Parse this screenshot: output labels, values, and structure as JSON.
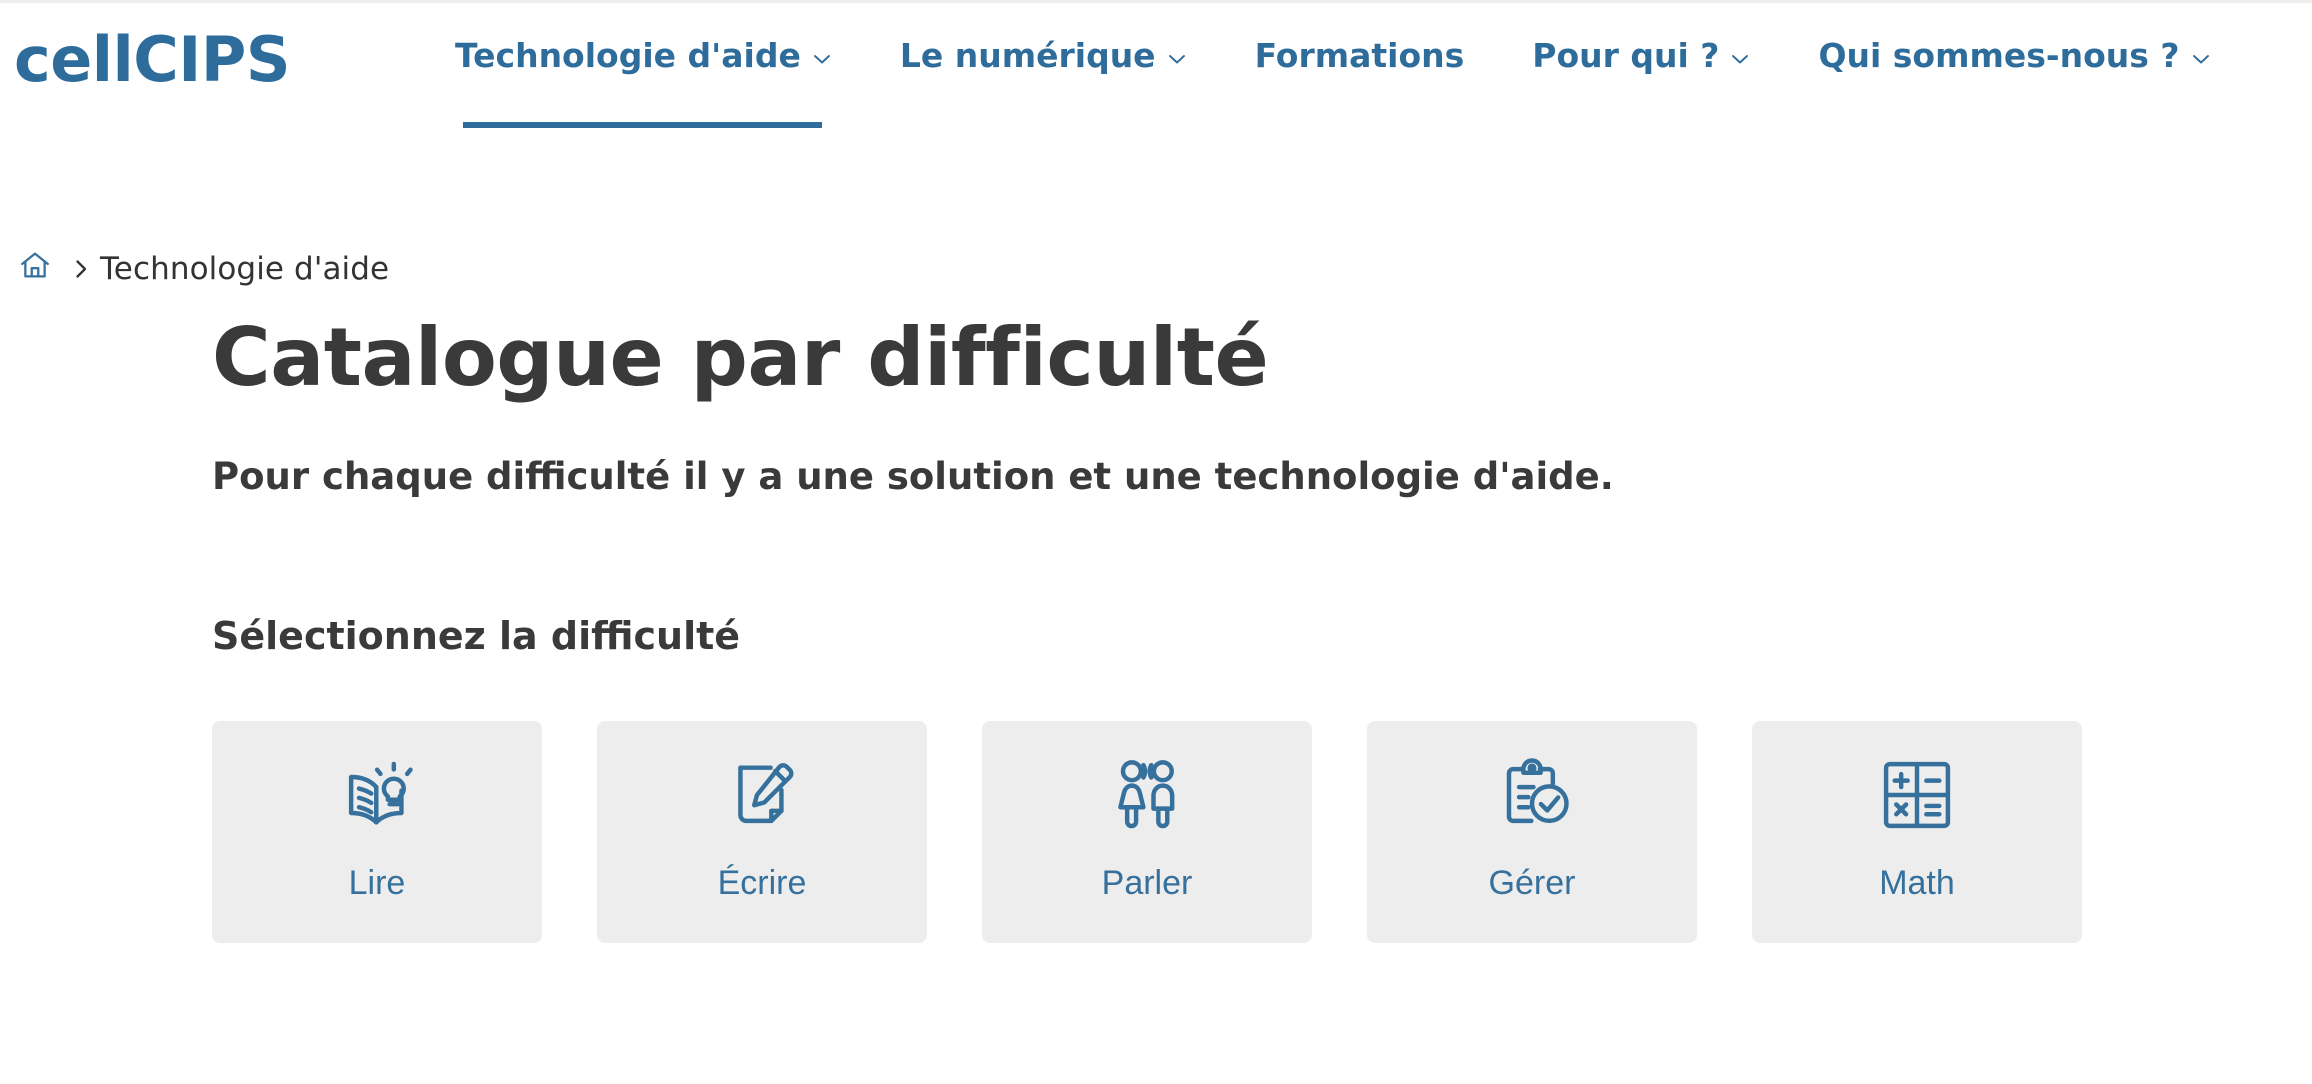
{
  "brand": {
    "name": "cellCIPS",
    "color": "#2e6d9b"
  },
  "nav": {
    "items": [
      {
        "label": "Technologie d'aide",
        "has_chevron": true,
        "active": true,
        "icon": "chevron-down-icon"
      },
      {
        "label": "Le numérique",
        "has_chevron": true,
        "active": false,
        "icon": "chevron-down-icon"
      },
      {
        "label": "Formations",
        "has_chevron": false,
        "active": false,
        "icon": ""
      },
      {
        "label": "Pour qui ?",
        "has_chevron": true,
        "active": false,
        "icon": "chevron-down-icon"
      },
      {
        "label": "Qui sommes-nous ?",
        "has_chevron": true,
        "active": false,
        "icon": "chevron-down-icon"
      }
    ]
  },
  "breadcrumb": {
    "home_icon": "home-icon",
    "separator_icon": "chevron-right-icon",
    "current": "Technologie d'aide"
  },
  "main": {
    "title": "Catalogue par difficulté",
    "lede": "Pour chaque difficulté il y a une solution et une technologie d'aide.",
    "section_title": "Sélectionnez la difficulté"
  },
  "cards": [
    {
      "label": "Lire",
      "icon": "open-book-lightbulb-icon"
    },
    {
      "label": "Écrire",
      "icon": "document-pencil-icon"
    },
    {
      "label": "Parler",
      "icon": "two-people-speaking-icon"
    },
    {
      "label": "Gérer",
      "icon": "clipboard-check-icon"
    },
    {
      "label": "Math",
      "icon": "calculator-operations-icon"
    }
  ],
  "colors": {
    "accent_blue": "#2e6d9b",
    "icon_blue": "#36709c",
    "card_bg": "#ededed",
    "text_dark": "#3a3a3a",
    "breadcrumb_text": "#333333",
    "hairline": "#eeeeee"
  }
}
